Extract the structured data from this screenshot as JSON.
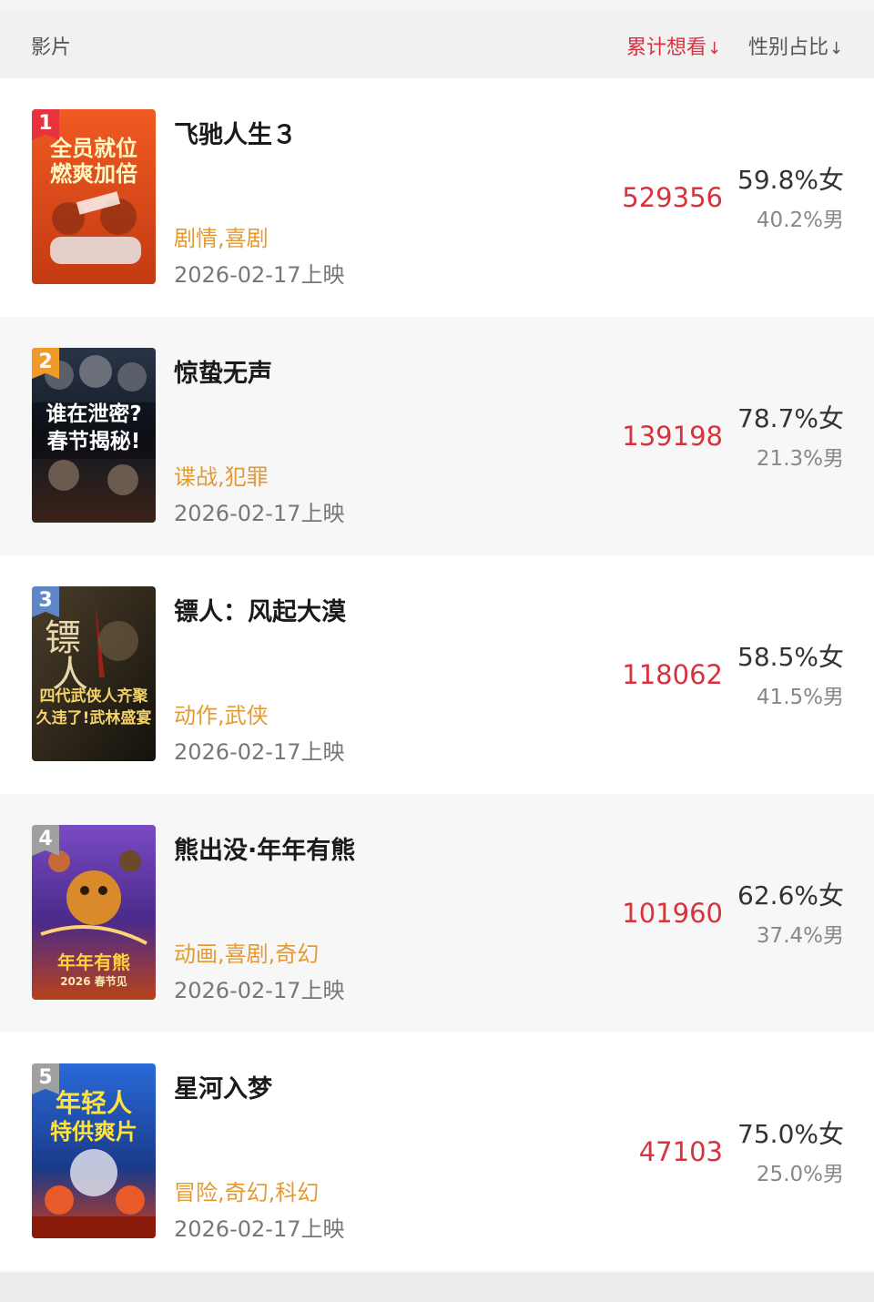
{
  "header": {
    "film": "影片",
    "want": "累计想看",
    "gender": "性别占比",
    "arrow": "↓"
  },
  "movies": [
    {
      "rank": "1",
      "title": "飞驰人生３",
      "genre": "剧情,喜剧",
      "date": "2026-02-17上映",
      "want": "529356",
      "female": "59.8%女",
      "male": "40.2%男",
      "poster_text": [
        "全员就位",
        "燃爽加倍"
      ],
      "poster_color": "#e04a1d"
    },
    {
      "rank": "2",
      "title": "惊蛰无声",
      "genre": "谍战,犯罪",
      "date": "2026-02-17上映",
      "want": "139198",
      "female": "78.7%女",
      "male": "21.3%男",
      "poster_text": [
        "谁在泄密?",
        "春节揭秘!"
      ],
      "poster_color": "#1a2433"
    },
    {
      "rank": "3",
      "title": "镖人：风起大漠",
      "genre": "动作,武侠",
      "date": "2026-02-17上映",
      "want": "118062",
      "female": "58.5%女",
      "male": "41.5%男",
      "poster_text": [
        "四代武侠人齐聚",
        "久违了!武林盛宴"
      ],
      "poster_color": "#2e261a"
    },
    {
      "rank": "4",
      "title": "熊出没·年年有熊",
      "genre": "动画,喜剧,奇幻",
      "date": "2026-02-17上映",
      "want": "101960",
      "female": "62.6%女",
      "male": "37.4%男",
      "poster_text": [
        "年年有熊",
        "2026 春节见"
      ],
      "poster_color": "#6a3fa8"
    },
    {
      "rank": "5",
      "title": "星河入梦",
      "genre": "冒险,奇幻,科幻",
      "date": "2026-02-17上映",
      "want": "47103",
      "female": "75.0%女",
      "male": "25.0%男",
      "poster_text": [
        "年轻人",
        "特供爽片"
      ],
      "poster_color": "#1f4fb3"
    }
  ]
}
